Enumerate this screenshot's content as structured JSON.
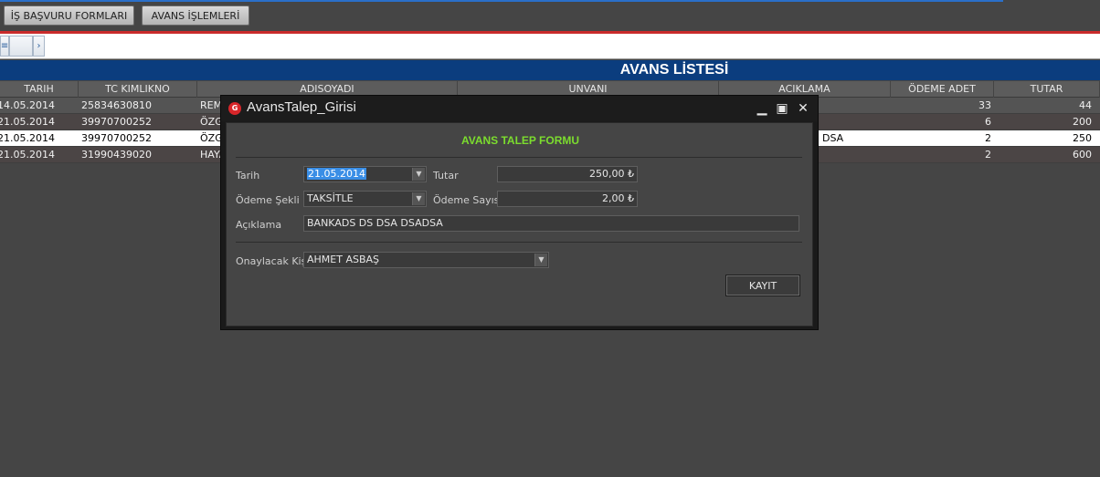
{
  "toolbar": {
    "buttons": [
      {
        "label": "İŞ BAŞVURU FORMLARI"
      },
      {
        "label": "AVANS İŞLEMLERİ"
      }
    ]
  },
  "list": {
    "title": "AVANS LİSTESİ",
    "columns": [
      "TARIH",
      "TC KIMLIKNO",
      "ADISOYADI",
      "UNVANI",
      "ACIKLAMA",
      "ÖDEME ADET",
      "TUTAR"
    ],
    "rows": [
      {
        "tarih": "14.05.2014",
        "tc": "25834630810",
        "ad": "REMZ",
        "aciklama": "",
        "adet": "33",
        "tutar": "44"
      },
      {
        "tarih": "21.05.2014",
        "tc": "39970700252",
        "ad": "ÖZGÜ",
        "aciklama": "",
        "adet": "6",
        "tutar": "200"
      },
      {
        "tarih": "21.05.2014",
        "tc": "39970700252",
        "ad": "ÖZGÜ",
        "aciklama": "DSA",
        "adet": "2",
        "tutar": "250"
      },
      {
        "tarih": "21.05.2014",
        "tc": "31990439020",
        "ad": "HAYA",
        "aciklama": "",
        "adet": "2",
        "tutar": "600"
      }
    ]
  },
  "dialog": {
    "title": "AvansTalep_Girisi",
    "icon": "app-icon",
    "form_title": "AVANS TALEP FORMU",
    "tarih_label": "Tarih",
    "tarih_value": "21.05.2014",
    "tutar_label": "Tutar",
    "tutar_value": "250,00 ₺",
    "odeme_sekli_label": "Ödeme Şekli",
    "odeme_sekli_value": "TAKSİTLE",
    "odeme_sayisi_label": "Ödeme Sayısı",
    "odeme_sayisi_value": "2,00 ₺",
    "aciklama_label": "Açıklama",
    "aciklama_value": "BANKADS DS DSA DSADSA",
    "onaylacak_label": "Onaylacak Kişi",
    "onaylacak_value": "AHMET ASBAŞ",
    "save_label": "KAYIT"
  }
}
